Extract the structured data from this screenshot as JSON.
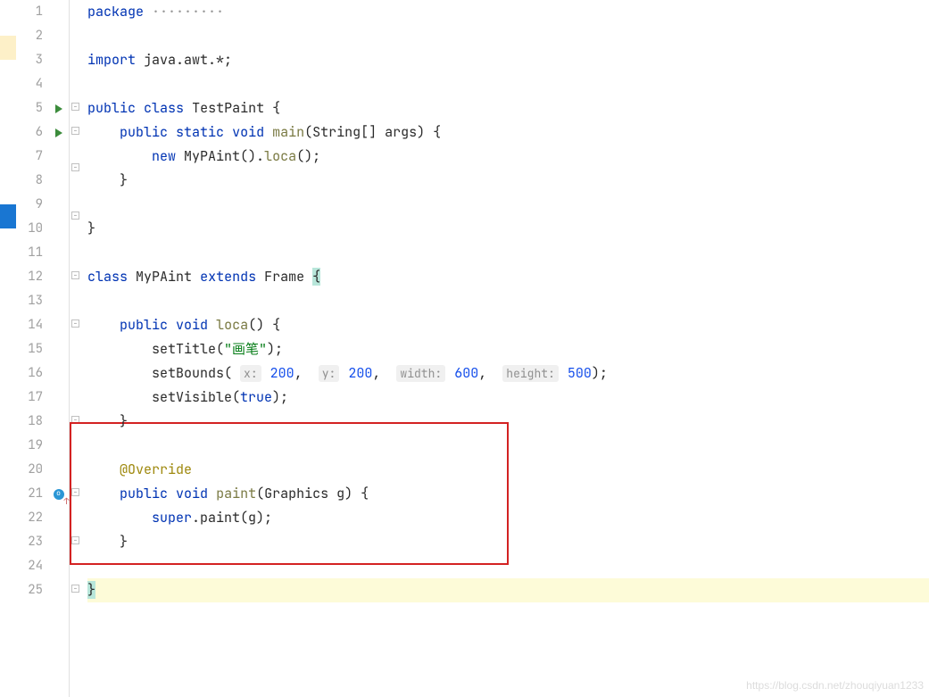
{
  "watermark": "https://blog.csdn.net/zhouqiyuan1233",
  "lineNumbers": [
    "1",
    "2",
    "3",
    "4",
    "5",
    "6",
    "7",
    "8",
    "9",
    "10",
    "11",
    "12",
    "13",
    "14",
    "15",
    "16",
    "17",
    "18",
    "19",
    "20",
    "21",
    "22",
    "23",
    "24",
    "25"
  ],
  "tokens": {
    "package": "package",
    "import": "import",
    "java_awt": "java.awt.*;",
    "public": "public",
    "class": "class",
    "TestPaint": "TestPaint",
    "lbrace": "{",
    "rbrace": "}",
    "static": "static",
    "void": "void",
    "main": "main",
    "main_sig": "(String[] args) {",
    "new": "new",
    "MyPAint_ctor": "MyPAint().",
    "loca_call": "loca",
    "loca_after": "();",
    "MyPAint": "MyPAint",
    "extends": "extends",
    "Frame": "Frame",
    "loca": "loca",
    "loca_sig": "() {",
    "setTitle": "setTitle(",
    "str_huabi": "\"画笔\"",
    "end_stmt": ");",
    "setBounds": "setBounds(",
    "hint_x": "x:",
    "hint_y": "y:",
    "hint_w": "width:",
    "hint_h": "height:",
    "n200a": "200",
    "n200b": "200",
    "n600": "600",
    "n500": "500",
    "comma": ", ",
    "setVisible": "setVisible(",
    "true": "true",
    "override": "@Override",
    "paint": "paint",
    "paint_sig": "(Graphics g) {",
    "super": "super",
    "super_call": ".paint(g);"
  }
}
